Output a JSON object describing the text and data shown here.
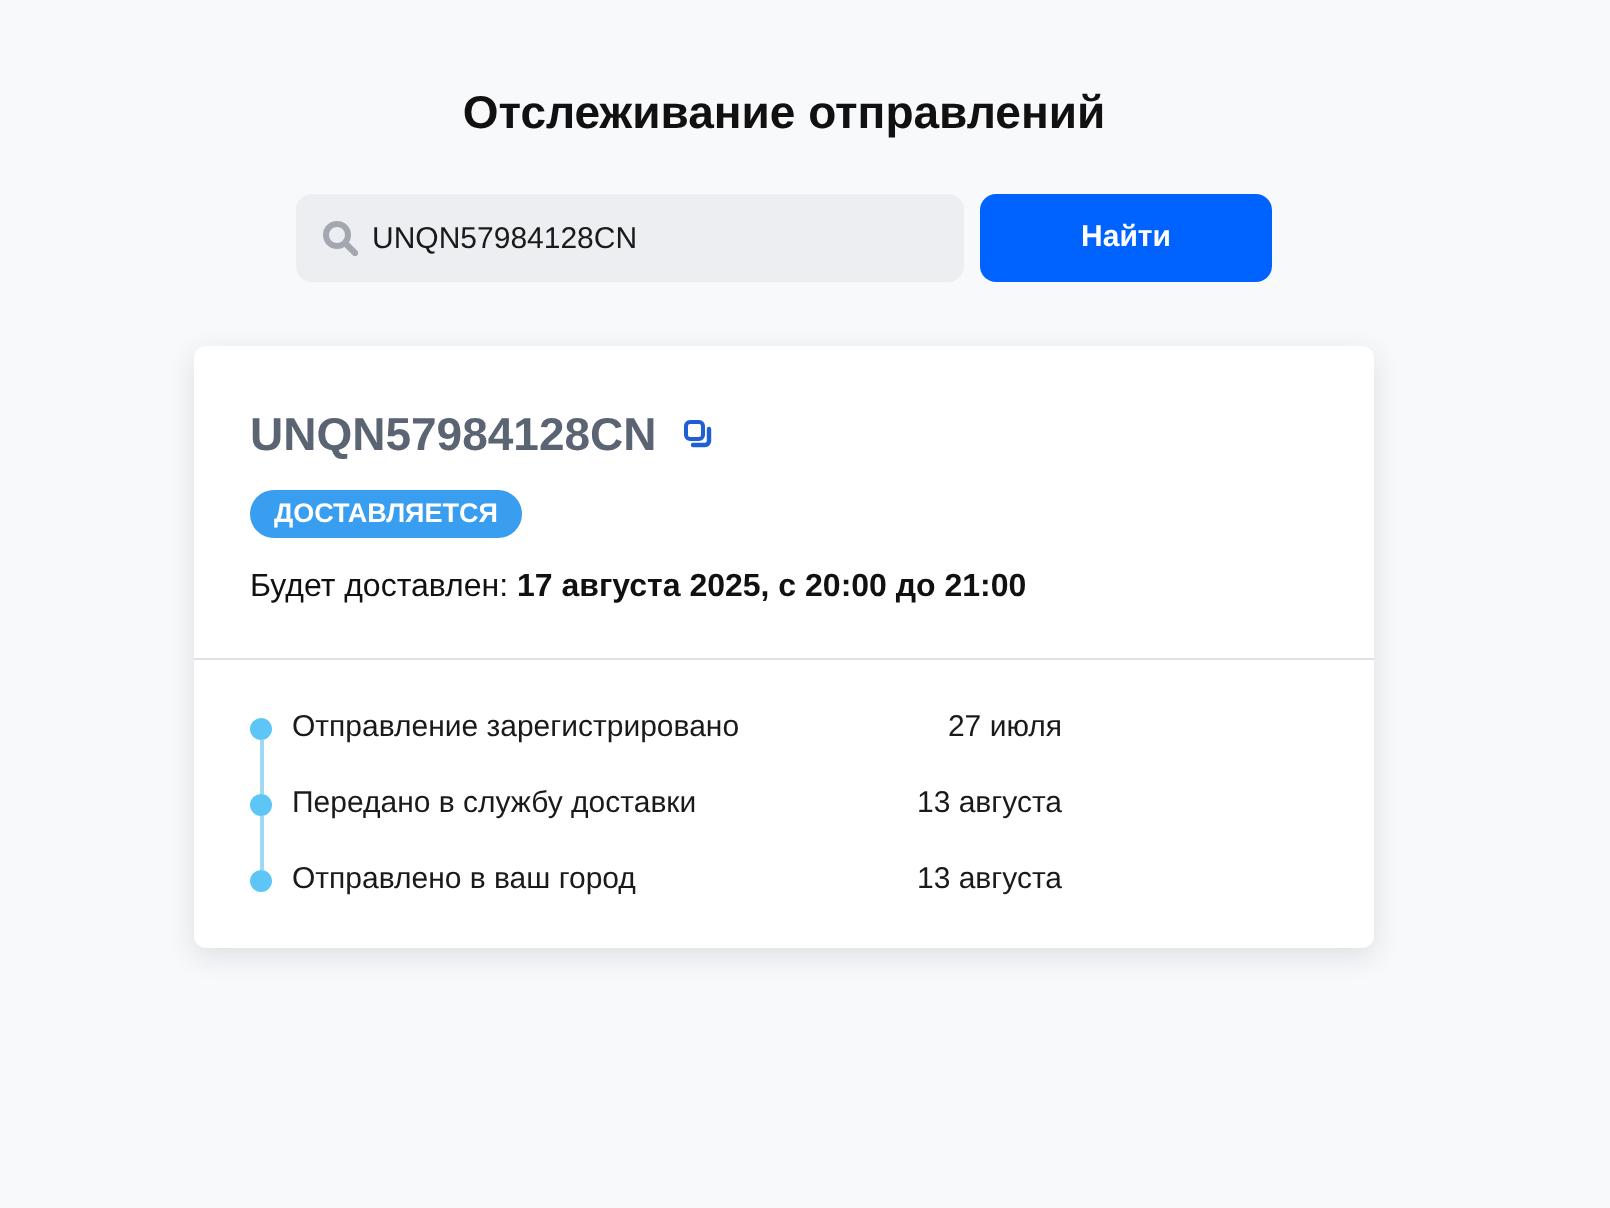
{
  "page": {
    "title": "Отслеживание отправлений"
  },
  "search": {
    "value": "UNQN57984128CN",
    "button": "Найти"
  },
  "shipment": {
    "tracking_number": "UNQN57984128CN",
    "status": "ДОСТАВЛЯЕТСЯ",
    "delivery_estimate": "Будет доставлен: **17 августа 2025, с 20:00 до 21:00**",
    "events": [
      {
        "label": "Отправление зарегистрировано",
        "date": "27 июля"
      },
      {
        "label": "Передано в службу доставки",
        "date": "13 августа"
      },
      {
        "label": "Отправлено в ваш город",
        "date": "13 августа"
      }
    ]
  }
}
